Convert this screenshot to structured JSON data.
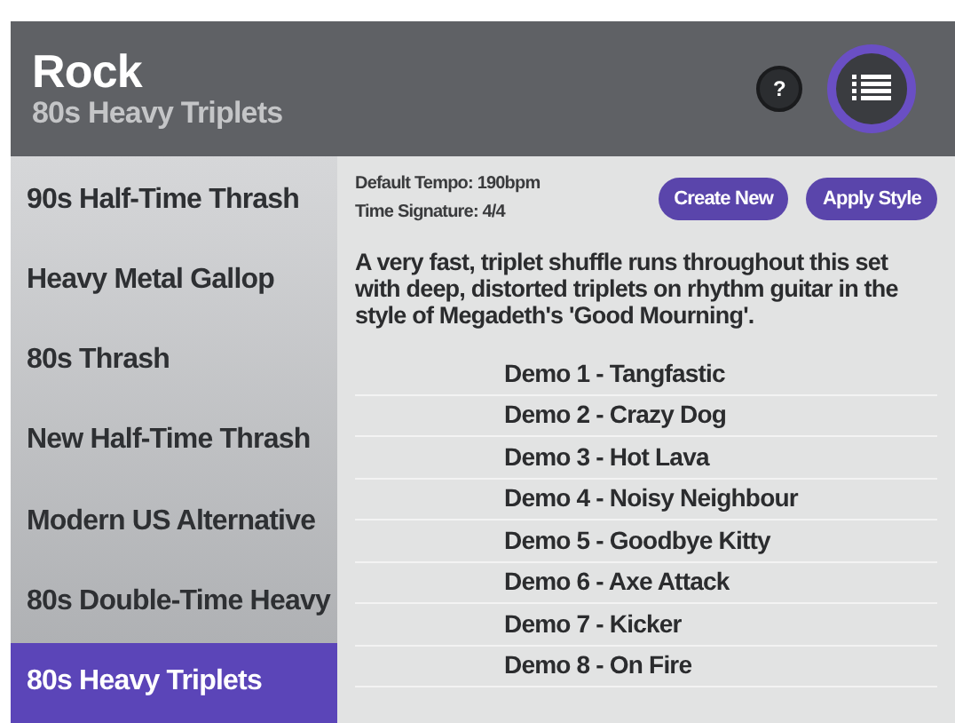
{
  "header": {
    "title": "Rock",
    "subtitle": "80s Heavy Triplets",
    "help_label": "?"
  },
  "sidebar": {
    "items": [
      {
        "label": "90s Half-Time Thrash",
        "selected": false
      },
      {
        "label": "Heavy Metal Gallop",
        "selected": false
      },
      {
        "label": "80s Thrash",
        "selected": false
      },
      {
        "label": "New Half-Time Thrash",
        "selected": false
      },
      {
        "label": "Modern US Alternative",
        "selected": false
      },
      {
        "label": "80s Double-Time Heavy",
        "selected": false
      },
      {
        "label": "80s Heavy Triplets",
        "selected": true
      }
    ]
  },
  "details": {
    "tempo": "Default Tempo: 190bpm",
    "time_signature": "Time Signature: 4/4",
    "buttons": [
      "Create New",
      "Apply Style"
    ],
    "description": "A very fast, triplet shuffle runs throughout this set with deep, distorted triplets on rhythm guitar in the style of  Megadeth's 'Good Mourning'.",
    "demos": [
      "Demo 1 - Tangfastic",
      "Demo 2 - Crazy Dog",
      "Demo 3 - Hot Lava",
      "Demo 4 - Noisy Neighbour",
      "Demo 5 - Goodbye Kitty",
      "Demo 6 - Axe Attack",
      "Demo 7 - Kicker",
      "Demo 8 - On Fire"
    ]
  }
}
